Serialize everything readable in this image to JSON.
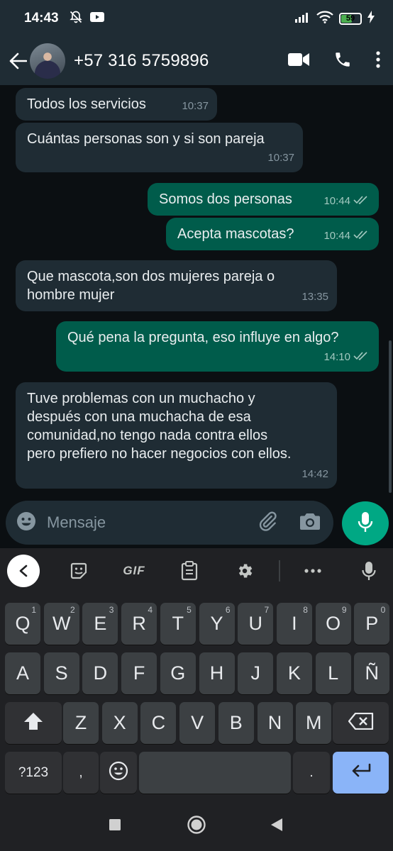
{
  "status_bar": {
    "time": "14:43",
    "battery": "59",
    "battery_level": 0.59
  },
  "header": {
    "contact": "+57 316 5759896",
    "icons": [
      "back-arrow-icon",
      "avatar",
      "video-call-icon",
      "phone-icon",
      "more-vert-icon"
    ]
  },
  "messages": [
    {
      "dir": "in",
      "text": "Todos los servicios",
      "time": "10:37"
    },
    {
      "dir": "in",
      "text": "Cuántas personas son y si son pareja",
      "time": "10:37"
    },
    {
      "dir": "out",
      "text": "Somos dos personas",
      "time": "10:44"
    },
    {
      "dir": "out",
      "text": "Acepta mascotas?",
      "time": "10:44"
    },
    {
      "dir": "in",
      "text": "Que mascota,son dos mujeres pareja o\nhombre mujer",
      "time": "13:35"
    },
    {
      "dir": "out",
      "text": "Qué pena la pregunta, eso influye en algo?",
      "time": "14:10"
    },
    {
      "dir": "in",
      "text": "Tuve problemas con un muchacho y\ndespués con una muchacha de esa\ncomunidad,no tengo nada contra ellos\npero prefiero no hacer negocios con ellos.",
      "time": "14:42"
    }
  ],
  "composer": {
    "placeholder": "Mensaje"
  },
  "keyboard": {
    "toolbar": {
      "gif": "GIF"
    },
    "row1": [
      {
        "k": "Q",
        "h": "1"
      },
      {
        "k": "W",
        "h": "2"
      },
      {
        "k": "E",
        "h": "3"
      },
      {
        "k": "R",
        "h": "4"
      },
      {
        "k": "T",
        "h": "5"
      },
      {
        "k": "Y",
        "h": "6"
      },
      {
        "k": "U",
        "h": "7"
      },
      {
        "k": "I",
        "h": "8"
      },
      {
        "k": "O",
        "h": "9"
      },
      {
        "k": "P",
        "h": "0"
      }
    ],
    "row2": [
      "A",
      "S",
      "D",
      "F",
      "G",
      "H",
      "J",
      "K",
      "L",
      "Ñ"
    ],
    "row3": [
      "Z",
      "X",
      "C",
      "V",
      "B",
      "N",
      "M"
    ],
    "symbols": "?123",
    "comma": ",",
    "period": "."
  },
  "colors": {
    "incoming_bubble": "#1f2c34",
    "outgoing_bubble": "#005c4b",
    "accent": "#00a884",
    "enter_key": "#8ab4f8"
  }
}
